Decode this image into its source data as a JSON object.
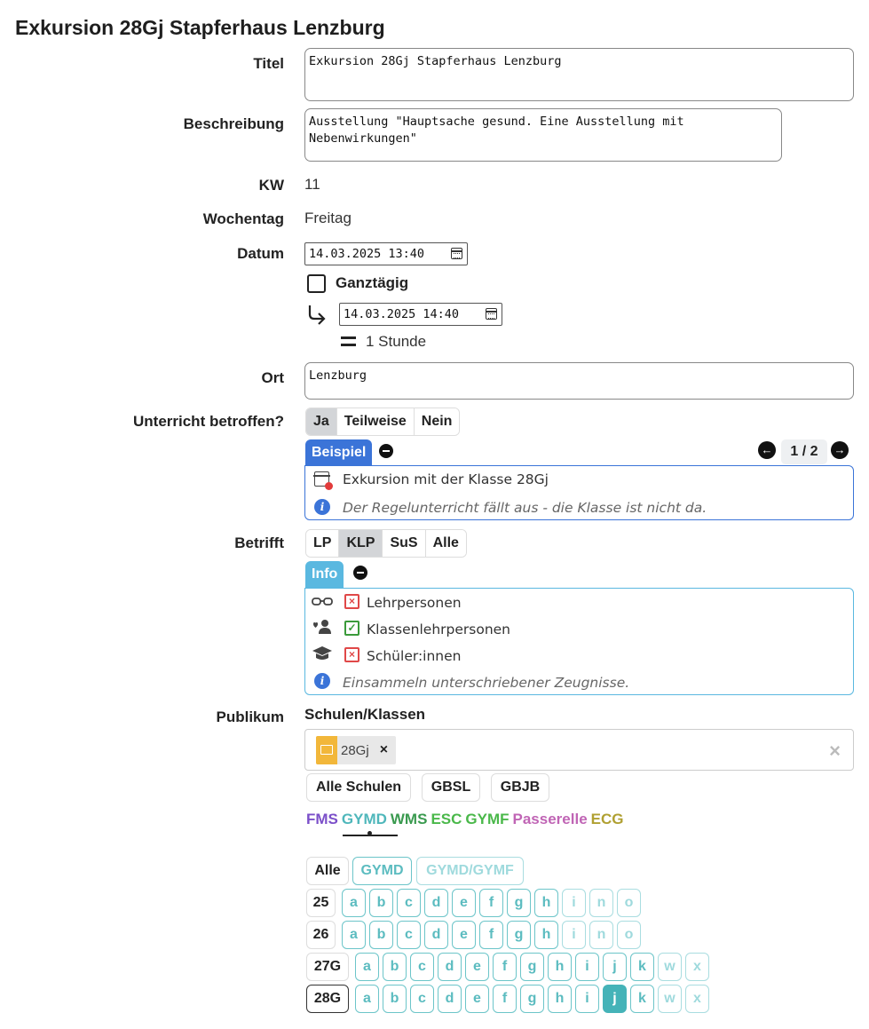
{
  "page_title": "Exkursion 28Gj Stapferhaus Lenzburg",
  "labels": {
    "titel": "Titel",
    "beschreibung": "Beschreibung",
    "kw": "KW",
    "wochentag": "Wochentag",
    "datum": "Datum",
    "ort": "Ort",
    "unterricht": "Unterricht betroffen?",
    "betrifft": "Betrifft",
    "publikum": "Publikum"
  },
  "fields": {
    "titel": "Exkursion 28Gj Stapferhaus Lenzburg",
    "beschreibung": "Ausstellung \"Hauptsache gesund. Eine Ausstellung mit Nebenwirkungen\"",
    "kw": "11",
    "wochentag": "Freitag",
    "start": "14.03.2025 13:40",
    "ganztaegig": "Ganztägig",
    "end": "14.03.2025 14:40",
    "duration": "1 Stunde",
    "ort": "Lenzburg"
  },
  "unterricht": {
    "options": [
      "Ja",
      "Teilweise",
      "Nein"
    ],
    "selected": "Ja",
    "panel_tab": "Beispiel",
    "pager": "1 / 2",
    "example_text": "Exkursion mit der Klasse 28Gj",
    "example_note": "Der Regelunterricht fällt aus - die Klasse ist nicht da.",
    "accent": "#3b74d8"
  },
  "betrifft": {
    "options": [
      "LP",
      "KLP",
      "SuS",
      "Alle"
    ],
    "selected": "KLP",
    "panel_tab": "Info",
    "rows": [
      {
        "icon": "glasses-icon",
        "status": "x",
        "label": "Lehrpersonen"
      },
      {
        "icon": "users-heart-icon",
        "status": "check",
        "label": "Klassenlehrpersonen"
      },
      {
        "icon": "graduation-cap-icon",
        "status": "x",
        "label": "Schüler:innen"
      }
    ],
    "note": "Einsammeln unterschriebener Zeugnisse.",
    "accent": "#5ab8e0"
  },
  "publikum": {
    "heading": "Schulen/Klassen",
    "chip": "28Gj",
    "schools": [
      "Alle Schulen",
      "GBSL",
      "GBJB"
    ],
    "tabs": [
      {
        "label": "FMS",
        "color": "#7b4fc9"
      },
      {
        "label": "GYMD",
        "color": "#4fb7bb"
      },
      {
        "label": "WMS",
        "color": "#3a9a4f"
      },
      {
        "label": "ESC",
        "color": "#4ab84a"
      },
      {
        "label": "GYMF",
        "color": "#4ab84a"
      },
      {
        "label": "Passerelle",
        "color": "#c065b5"
      },
      {
        "label": "ECG",
        "color": "#b0a032"
      }
    ],
    "active_tab": "GYMD",
    "filters": [
      "Alle",
      "GYMD",
      "GYMD/GYMF"
    ],
    "years": [
      {
        "label": "25",
        "classes": [
          "a",
          "b",
          "c",
          "d",
          "e",
          "f",
          "g",
          "h",
          "i",
          "n",
          "o"
        ]
      },
      {
        "label": "26",
        "classes": [
          "a",
          "b",
          "c",
          "d",
          "e",
          "f",
          "g",
          "h",
          "i",
          "n",
          "o"
        ]
      },
      {
        "label": "27G",
        "classes": [
          "a",
          "b",
          "c",
          "d",
          "e",
          "f",
          "g",
          "h",
          "i",
          "j",
          "k",
          "w",
          "x"
        ]
      },
      {
        "label": "28G",
        "classes": [
          "a",
          "b",
          "c",
          "d",
          "e",
          "f",
          "g",
          "h",
          "i",
          "j",
          "k",
          "w",
          "x"
        ]
      }
    ],
    "selected_class": "28G-j"
  }
}
